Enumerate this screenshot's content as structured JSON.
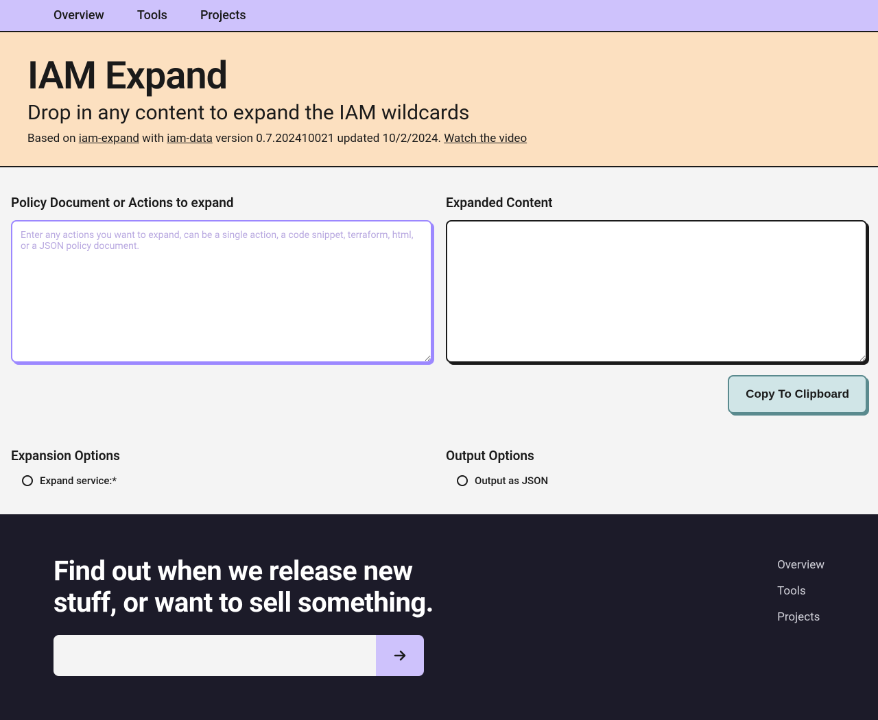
{
  "nav": {
    "items": [
      {
        "label": "Overview"
      },
      {
        "label": "Tools"
      },
      {
        "label": "Projects"
      }
    ]
  },
  "hero": {
    "title": "IAM Expand",
    "subtitle": "Drop in any content to expand the IAM wildcards",
    "meta_prefix": "Based on ",
    "link1": "iam-expand",
    "meta_mid": " with ",
    "link2": "iam-data",
    "version_text": " version 0.7.202410021 updated 10/2/2024. ",
    "video_link": "Watch the video"
  },
  "input": {
    "label": "Policy Document or Actions to expand",
    "placeholder": "Enter any actions you want to expand, can be a single action, a code snippet, terraform, html, or a JSON policy document."
  },
  "output": {
    "label": "Expanded Content",
    "copy_button": "Copy To Clipboard"
  },
  "expansion_options": {
    "title": "Expansion Options",
    "option1": "Expand service:*"
  },
  "output_options": {
    "title": "Output Options",
    "option1": "Output as JSON"
  },
  "footer": {
    "heading": "Find out when we release new stuff, or want to sell something.",
    "links": [
      {
        "label": "Overview"
      },
      {
        "label": "Tools"
      },
      {
        "label": "Projects"
      }
    ]
  }
}
